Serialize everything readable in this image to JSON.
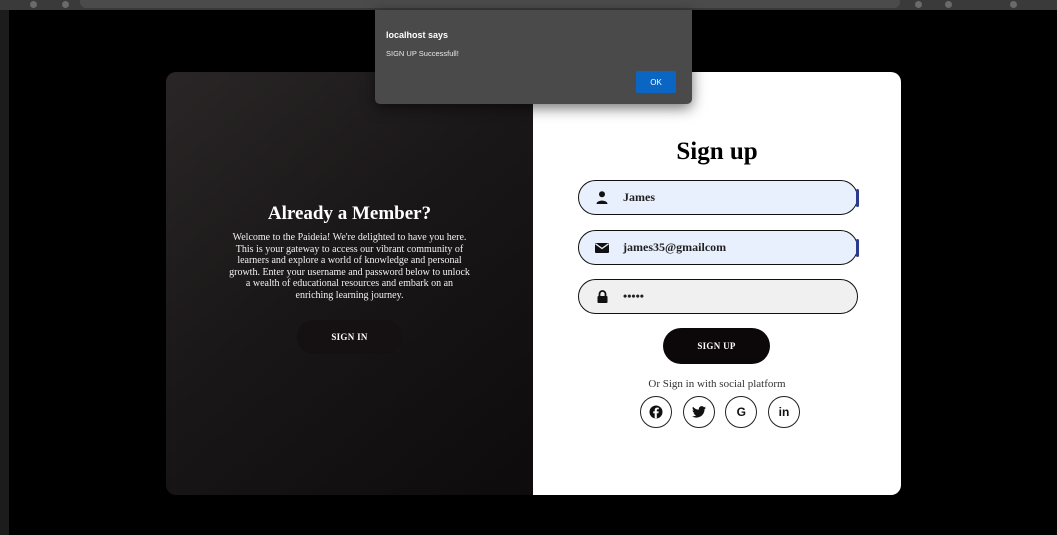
{
  "left_panel": {
    "title": "Already a Member?",
    "description": "Welcome to the Paideia! We're delighted to have you here. This is your gateway to access our vibrant community of learners and explore a world of knowledge and personal growth. Enter your username and password below to unlock a wealth of educational resources and embark on an enriching learning journey.",
    "signin_label": "SIGN IN"
  },
  "signup_form": {
    "title": "Sign up",
    "username_value": "James",
    "username_icon": "user-icon",
    "email_value": "james35@gmailcom",
    "email_icon": "envelope-icon",
    "password_value": "•••••",
    "password_icon": "lock-icon",
    "signup_label": "SIGN UP",
    "social_text": "Or Sign in with social platform",
    "socials": [
      {
        "icon": "facebook-icon",
        "glyph": "f"
      },
      {
        "icon": "twitter-icon",
        "glyph": "t"
      },
      {
        "icon": "google-icon",
        "glyph": "G"
      },
      {
        "icon": "linkedin-icon",
        "glyph": "in"
      }
    ]
  },
  "dialog": {
    "title": "localhost says",
    "message": "SIGN UP Successfull!",
    "ok_label": "OK"
  },
  "colors": {
    "accent_button": "#0a66c2",
    "autofill_bg": "#e8f0fe",
    "dark_button": "#0c0709"
  }
}
